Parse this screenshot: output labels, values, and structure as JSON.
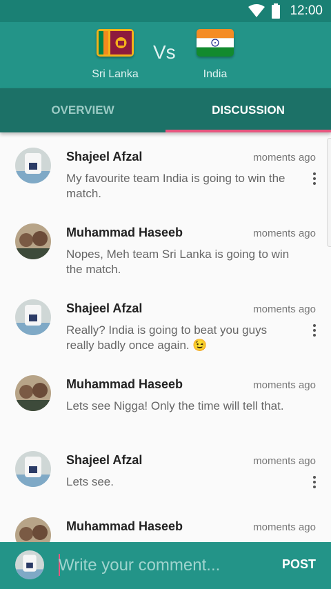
{
  "status_bar": {
    "time": "12:00",
    "icons": [
      "wifi-icon",
      "battery-icon"
    ]
  },
  "match": {
    "team1": {
      "name": "Sri Lanka",
      "flag": "sri-lanka-flag"
    },
    "vs": "Vs",
    "team2": {
      "name": "India",
      "flag": "india-flag"
    }
  },
  "tabs": [
    {
      "label": "OVERVIEW",
      "active": false
    },
    {
      "label": "DISCUSSION",
      "active": true
    }
  ],
  "comments": [
    {
      "author": "Shajeel Afzal",
      "time": "moments ago",
      "text": "My favourite team India is going to win the match.",
      "has_menu": true
    },
    {
      "author": "Muhammad Haseeb",
      "time": "moments ago",
      "text": "Nopes, Meh team Sri Lanka is going to win the match.",
      "has_menu": false
    },
    {
      "author": "Shajeel Afzal",
      "time": "moments ago",
      "text": " Really? India is going to beat you guys really badly once again. 😉",
      "has_menu": true
    },
    {
      "author": "Muhammad Haseeb",
      "time": "moments ago",
      "text": "Lets see Nigga! Only the time will tell that.",
      "has_menu": false
    },
    {
      "author": "Shajeel Afzal",
      "time": "moments ago",
      "text": "Lets see.",
      "has_menu": true
    },
    {
      "author": "Muhammad Haseeb",
      "time": "moments ago",
      "text": "",
      "has_menu": false
    }
  ],
  "comment_box": {
    "placeholder": "Write your comment...",
    "value": "",
    "post_label": "POST"
  },
  "colors": {
    "primary": "#239488",
    "primary_dark": "#1c7167",
    "accent": "#e8567f"
  }
}
